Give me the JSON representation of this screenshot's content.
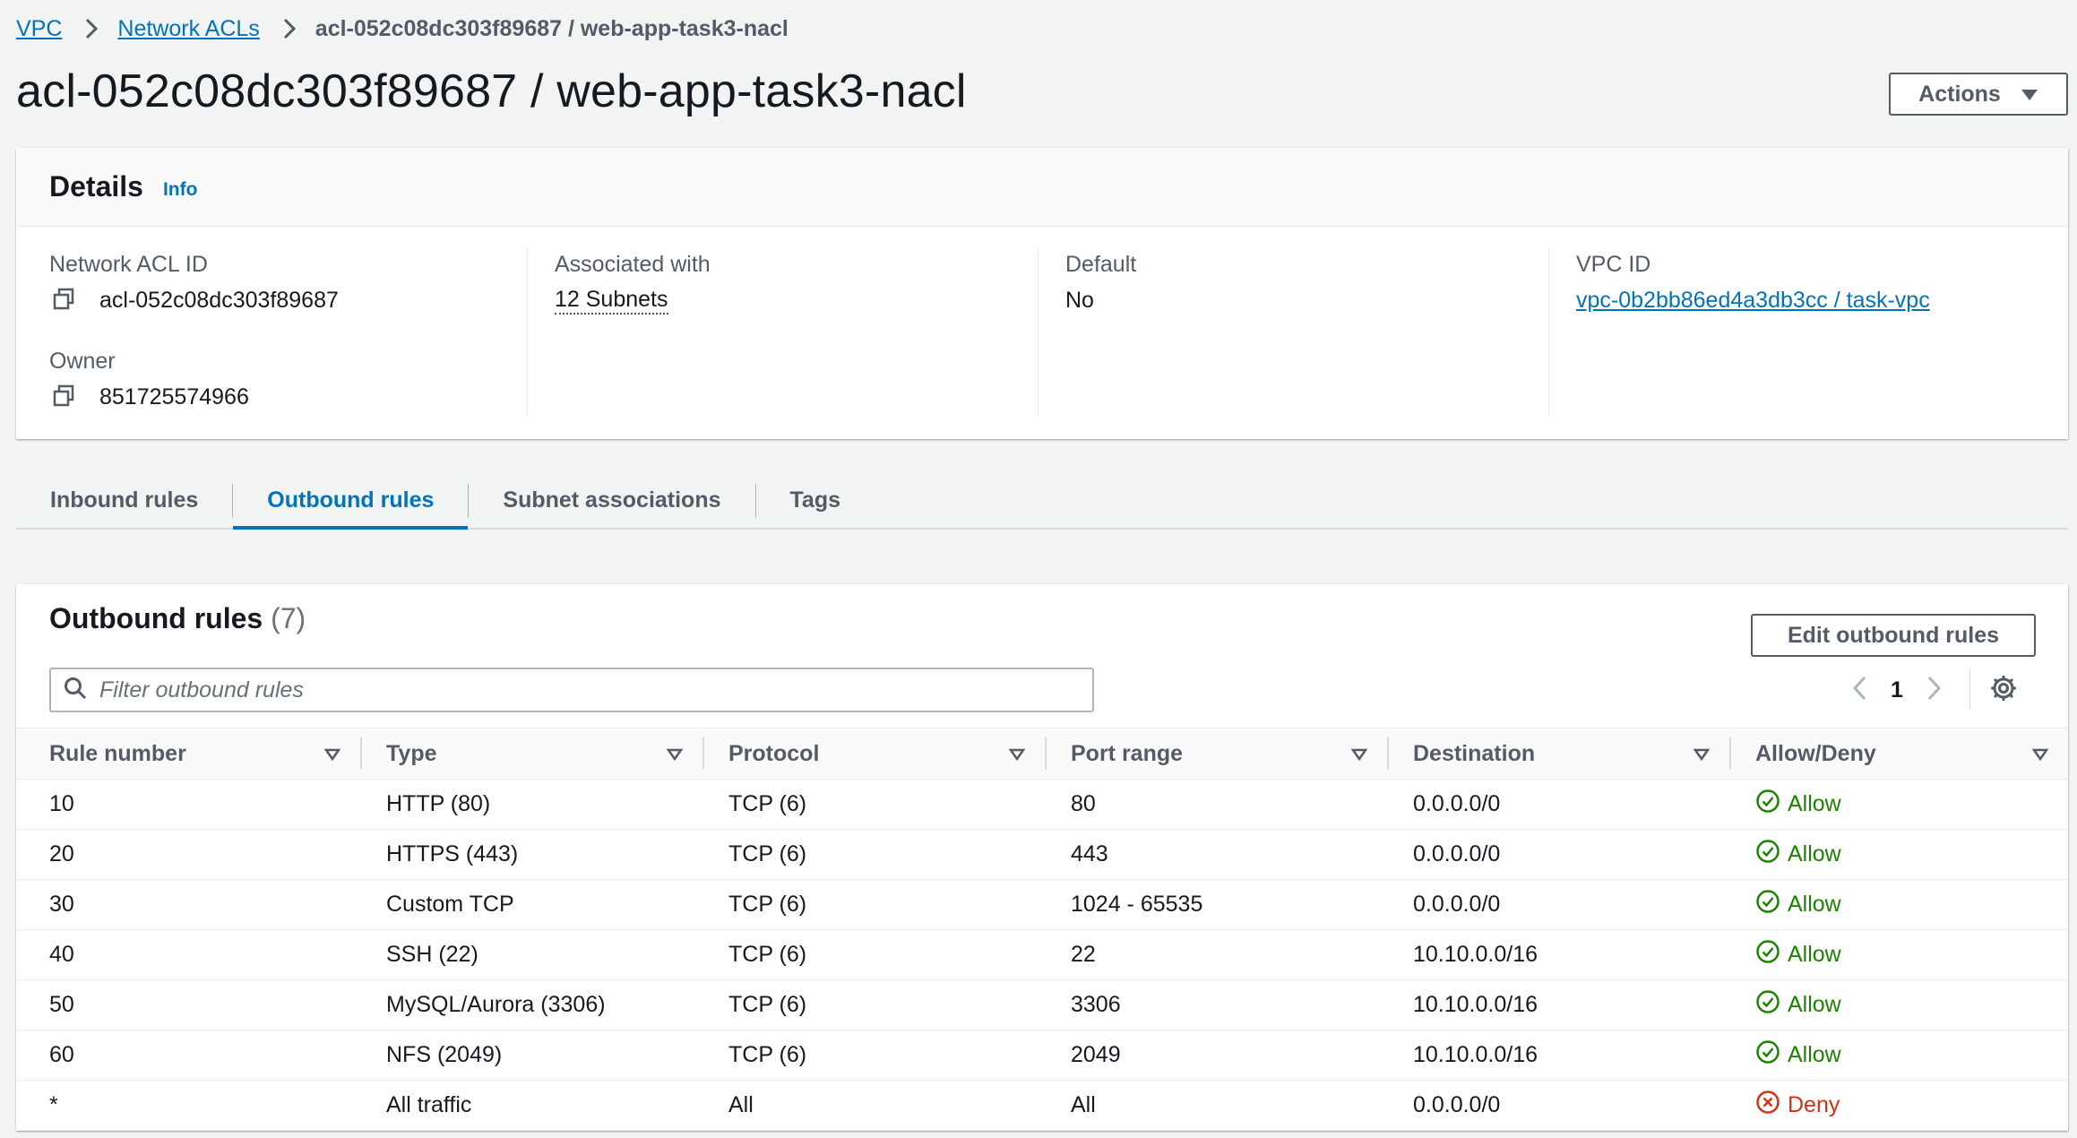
{
  "breadcrumb": {
    "items": [
      "VPC",
      "Network ACLs"
    ],
    "current": "acl-052c08dc303f89687 / web-app-task3-nacl"
  },
  "page": {
    "title": "acl-052c08dc303f89687 / web-app-task3-nacl",
    "actions_label": "Actions"
  },
  "details": {
    "title": "Details",
    "info_label": "Info",
    "acl_id_label": "Network ACL ID",
    "acl_id": "acl-052c08dc303f89687",
    "owner_label": "Owner",
    "owner": "851725574966",
    "associated_label": "Associated with",
    "associated": "12 Subnets",
    "default_label": "Default",
    "default": "No",
    "vpc_label": "VPC ID",
    "vpc": "vpc-0b2bb86ed4a3db3cc / task-vpc"
  },
  "tabs": [
    {
      "label": "Inbound rules"
    },
    {
      "label": "Outbound rules"
    },
    {
      "label": "Subnet associations"
    },
    {
      "label": "Tags"
    }
  ],
  "rules": {
    "title": "Outbound rules",
    "count": "(7)",
    "edit_label": "Edit outbound rules",
    "filter_placeholder": "Filter outbound rules",
    "page": "1",
    "columns": [
      "Rule number",
      "Type",
      "Protocol",
      "Port range",
      "Destination",
      "Allow/Deny"
    ],
    "rows": [
      {
        "rule": "10",
        "type": "HTTP (80)",
        "protocol": "TCP (6)",
        "port": "80",
        "dest": "0.0.0.0/0",
        "action": "Allow"
      },
      {
        "rule": "20",
        "type": "HTTPS (443)",
        "protocol": "TCP (6)",
        "port": "443",
        "dest": "0.0.0.0/0",
        "action": "Allow"
      },
      {
        "rule": "30",
        "type": "Custom TCP",
        "protocol": "TCP (6)",
        "port": "1024 - 65535",
        "dest": "0.0.0.0/0",
        "action": "Allow"
      },
      {
        "rule": "40",
        "type": "SSH (22)",
        "protocol": "TCP (6)",
        "port": "22",
        "dest": "10.10.0.0/16",
        "action": "Allow"
      },
      {
        "rule": "50",
        "type": "MySQL/Aurora (3306)",
        "protocol": "TCP (6)",
        "port": "3306",
        "dest": "10.10.0.0/16",
        "action": "Allow"
      },
      {
        "rule": "60",
        "type": "NFS (2049)",
        "protocol": "TCP (6)",
        "port": "2049",
        "dest": "10.10.0.0/16",
        "action": "Allow"
      },
      {
        "rule": "*",
        "type": "All traffic",
        "protocol": "All",
        "port": "All",
        "dest": "0.0.0.0/0",
        "action": "Deny"
      }
    ]
  },
  "colors": {
    "link": "#0073bb",
    "allow": "#1d8102",
    "deny": "#d13212",
    "background": "#f2f3f3"
  }
}
